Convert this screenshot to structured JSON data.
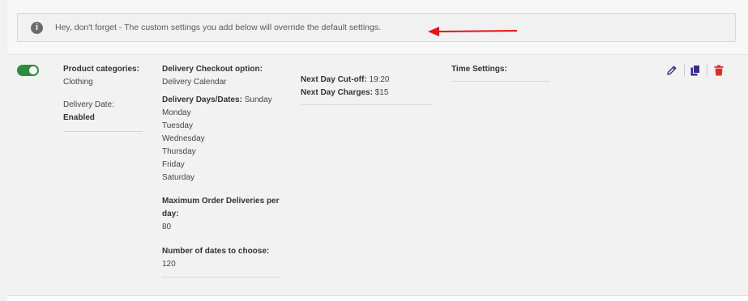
{
  "notice": {
    "text": "Hey, don't forget - The custom settings you add below will override the default settings.",
    "icon": "info-circle-icon"
  },
  "row": {
    "enabled": true,
    "product_categories_label": "Product categories:",
    "product_categories_value": "Clothing",
    "delivery_date_label": "Delivery Date:",
    "delivery_date_value": "Enabled",
    "checkout_option_label": "Delivery Checkout option:",
    "checkout_option_value": "Delivery Calendar",
    "days_label": "Delivery Days/Dates:",
    "days": [
      "Sunday",
      "Monday",
      "Tuesday",
      "Wednesday",
      "Thursday",
      "Friday",
      "Saturday"
    ],
    "max_orders_label": "Maximum Order Deliveries per day:",
    "max_orders_value": "80",
    "num_dates_label": "Number of dates to choose:",
    "num_dates_value": "120",
    "cutoff_label": "Next Day Cut-off:",
    "cutoff_value": "19:20",
    "charges_label": "Next Day Charges:",
    "charges_value": "$15",
    "time_settings_label": "Time Settings:"
  },
  "actions": {
    "edit_icon": "pencil-icon",
    "copy_icon": "copy-icon",
    "delete_icon": "trash-icon",
    "accent": "#3a2a8c",
    "danger": "#e02b2b"
  }
}
